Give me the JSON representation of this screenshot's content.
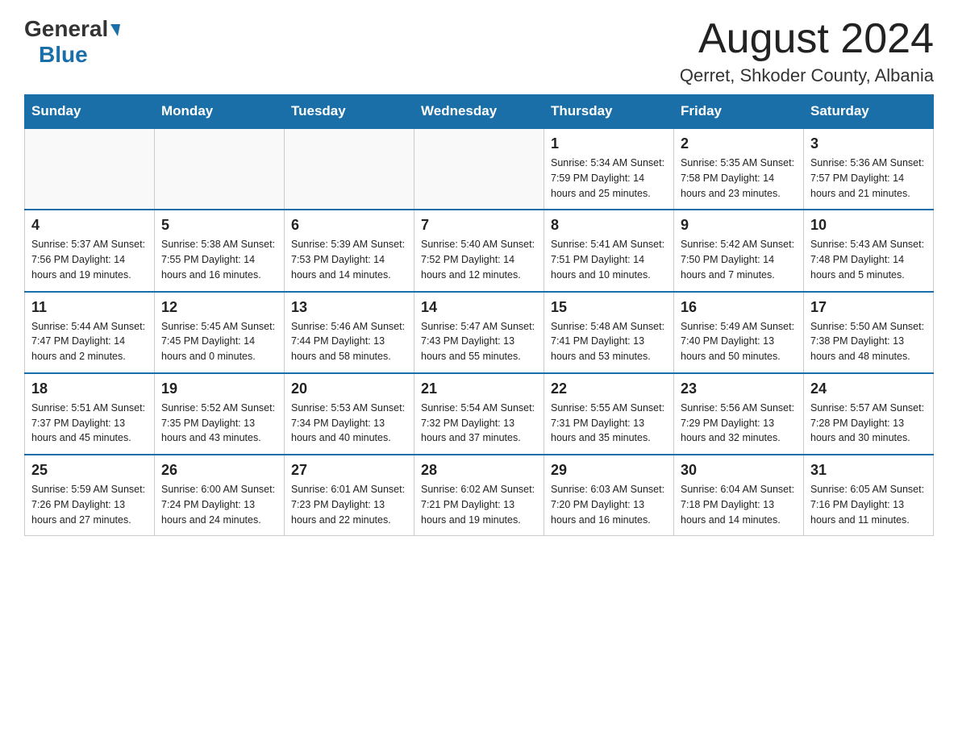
{
  "header": {
    "logo_general": "General",
    "logo_blue": "Blue",
    "month_title": "August 2024",
    "location": "Qerret, Shkoder County, Albania"
  },
  "days_of_week": [
    "Sunday",
    "Monday",
    "Tuesday",
    "Wednesday",
    "Thursday",
    "Friday",
    "Saturday"
  ],
  "weeks": [
    [
      {
        "day": "",
        "info": ""
      },
      {
        "day": "",
        "info": ""
      },
      {
        "day": "",
        "info": ""
      },
      {
        "day": "",
        "info": ""
      },
      {
        "day": "1",
        "info": "Sunrise: 5:34 AM\nSunset: 7:59 PM\nDaylight: 14 hours\nand 25 minutes."
      },
      {
        "day": "2",
        "info": "Sunrise: 5:35 AM\nSunset: 7:58 PM\nDaylight: 14 hours\nand 23 minutes."
      },
      {
        "day": "3",
        "info": "Sunrise: 5:36 AM\nSunset: 7:57 PM\nDaylight: 14 hours\nand 21 minutes."
      }
    ],
    [
      {
        "day": "4",
        "info": "Sunrise: 5:37 AM\nSunset: 7:56 PM\nDaylight: 14 hours\nand 19 minutes."
      },
      {
        "day": "5",
        "info": "Sunrise: 5:38 AM\nSunset: 7:55 PM\nDaylight: 14 hours\nand 16 minutes."
      },
      {
        "day": "6",
        "info": "Sunrise: 5:39 AM\nSunset: 7:53 PM\nDaylight: 14 hours\nand 14 minutes."
      },
      {
        "day": "7",
        "info": "Sunrise: 5:40 AM\nSunset: 7:52 PM\nDaylight: 14 hours\nand 12 minutes."
      },
      {
        "day": "8",
        "info": "Sunrise: 5:41 AM\nSunset: 7:51 PM\nDaylight: 14 hours\nand 10 minutes."
      },
      {
        "day": "9",
        "info": "Sunrise: 5:42 AM\nSunset: 7:50 PM\nDaylight: 14 hours\nand 7 minutes."
      },
      {
        "day": "10",
        "info": "Sunrise: 5:43 AM\nSunset: 7:48 PM\nDaylight: 14 hours\nand 5 minutes."
      }
    ],
    [
      {
        "day": "11",
        "info": "Sunrise: 5:44 AM\nSunset: 7:47 PM\nDaylight: 14 hours\nand 2 minutes."
      },
      {
        "day": "12",
        "info": "Sunrise: 5:45 AM\nSunset: 7:45 PM\nDaylight: 14 hours\nand 0 minutes."
      },
      {
        "day": "13",
        "info": "Sunrise: 5:46 AM\nSunset: 7:44 PM\nDaylight: 13 hours\nand 58 minutes."
      },
      {
        "day": "14",
        "info": "Sunrise: 5:47 AM\nSunset: 7:43 PM\nDaylight: 13 hours\nand 55 minutes."
      },
      {
        "day": "15",
        "info": "Sunrise: 5:48 AM\nSunset: 7:41 PM\nDaylight: 13 hours\nand 53 minutes."
      },
      {
        "day": "16",
        "info": "Sunrise: 5:49 AM\nSunset: 7:40 PM\nDaylight: 13 hours\nand 50 minutes."
      },
      {
        "day": "17",
        "info": "Sunrise: 5:50 AM\nSunset: 7:38 PM\nDaylight: 13 hours\nand 48 minutes."
      }
    ],
    [
      {
        "day": "18",
        "info": "Sunrise: 5:51 AM\nSunset: 7:37 PM\nDaylight: 13 hours\nand 45 minutes."
      },
      {
        "day": "19",
        "info": "Sunrise: 5:52 AM\nSunset: 7:35 PM\nDaylight: 13 hours\nand 43 minutes."
      },
      {
        "day": "20",
        "info": "Sunrise: 5:53 AM\nSunset: 7:34 PM\nDaylight: 13 hours\nand 40 minutes."
      },
      {
        "day": "21",
        "info": "Sunrise: 5:54 AM\nSunset: 7:32 PM\nDaylight: 13 hours\nand 37 minutes."
      },
      {
        "day": "22",
        "info": "Sunrise: 5:55 AM\nSunset: 7:31 PM\nDaylight: 13 hours\nand 35 minutes."
      },
      {
        "day": "23",
        "info": "Sunrise: 5:56 AM\nSunset: 7:29 PM\nDaylight: 13 hours\nand 32 minutes."
      },
      {
        "day": "24",
        "info": "Sunrise: 5:57 AM\nSunset: 7:28 PM\nDaylight: 13 hours\nand 30 minutes."
      }
    ],
    [
      {
        "day": "25",
        "info": "Sunrise: 5:59 AM\nSunset: 7:26 PM\nDaylight: 13 hours\nand 27 minutes."
      },
      {
        "day": "26",
        "info": "Sunrise: 6:00 AM\nSunset: 7:24 PM\nDaylight: 13 hours\nand 24 minutes."
      },
      {
        "day": "27",
        "info": "Sunrise: 6:01 AM\nSunset: 7:23 PM\nDaylight: 13 hours\nand 22 minutes."
      },
      {
        "day": "28",
        "info": "Sunrise: 6:02 AM\nSunset: 7:21 PM\nDaylight: 13 hours\nand 19 minutes."
      },
      {
        "day": "29",
        "info": "Sunrise: 6:03 AM\nSunset: 7:20 PM\nDaylight: 13 hours\nand 16 minutes."
      },
      {
        "day": "30",
        "info": "Sunrise: 6:04 AM\nSunset: 7:18 PM\nDaylight: 13 hours\nand 14 minutes."
      },
      {
        "day": "31",
        "info": "Sunrise: 6:05 AM\nSunset: 7:16 PM\nDaylight: 13 hours\nand 11 minutes."
      }
    ]
  ]
}
